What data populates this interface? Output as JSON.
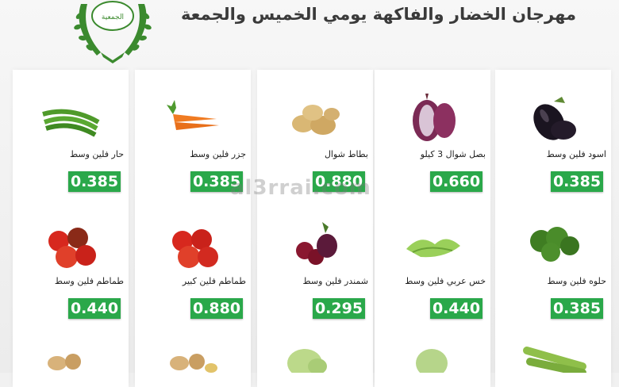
{
  "header": {
    "logo_text": "الجمعية",
    "title": "مهرجان الخضار والفاكهة يومي الخميس والجمعة"
  },
  "watermark": "al3rrai.com",
  "colors": {
    "price_bg": "#2aa84a",
    "logo_green": "#3b8a2e"
  },
  "products": [
    {
      "name": "اسود فلين وسط",
      "price": "0.385",
      "icon": "eggplant-icon"
    },
    {
      "name": "بصل شوال 3 كيلو",
      "price": "0.660",
      "icon": "red-onion-icon"
    },
    {
      "name": "بطاط شوال",
      "price": "0.880",
      "icon": "potato-icon"
    },
    {
      "name": "جزر فلين وسط",
      "price": "0.385",
      "icon": "carrot-icon"
    },
    {
      "name": "حار فلين وسط",
      "price": "0.385",
      "icon": "green-chili-icon"
    },
    {
      "name": "حلوه فلين وسط",
      "price": "0.385",
      "icon": "broccoli-icon"
    },
    {
      "name": "خس عربي فلين وسط",
      "price": "0.440",
      "icon": "lettuce-icon"
    },
    {
      "name": "شمندر فلين وسط",
      "price": "0.295",
      "icon": "beetroot-icon"
    },
    {
      "name": "طماطم فلين كبير",
      "price": "0.880",
      "icon": "tomato-icon"
    },
    {
      "name": "طماطم فلين وسط",
      "price": "0.440",
      "icon": "tomato-icon"
    }
  ]
}
